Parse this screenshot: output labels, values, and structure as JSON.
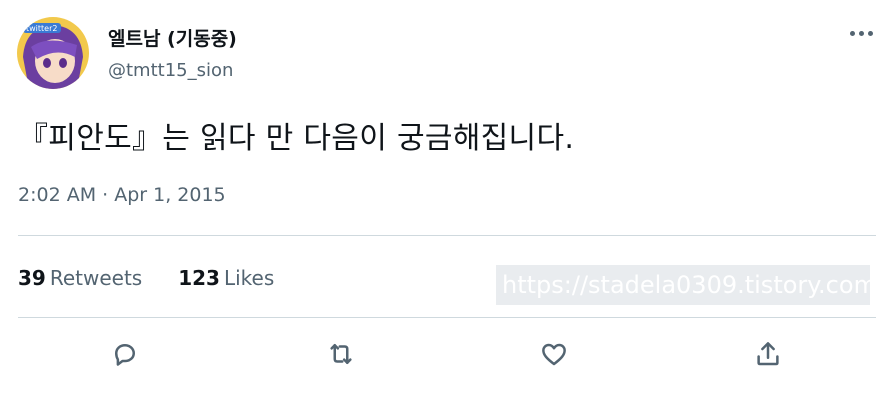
{
  "author": {
    "display_name": "엘트남 (기동중)",
    "handle": "@tmtt15_sion",
    "avatar_badge_text": "twitter2"
  },
  "tweet": {
    "text": "『피안도』는 읽다 만 다음이 궁금해집니다.",
    "timestamp": "2:02 AM · Apr 1, 2015"
  },
  "stats": {
    "retweets_count": "39",
    "retweets_label": "Retweets",
    "likes_count": "123",
    "likes_label": "Likes"
  },
  "watermark": "https://stadela0309.tistory.com",
  "icons": {
    "more": "more-icon",
    "reply": "reply-icon",
    "retweet": "retweet-icon",
    "like": "like-icon",
    "share": "share-icon"
  },
  "colors": {
    "text_primary": "#0f1419",
    "text_secondary": "#536471",
    "divider": "#cfd9de"
  }
}
